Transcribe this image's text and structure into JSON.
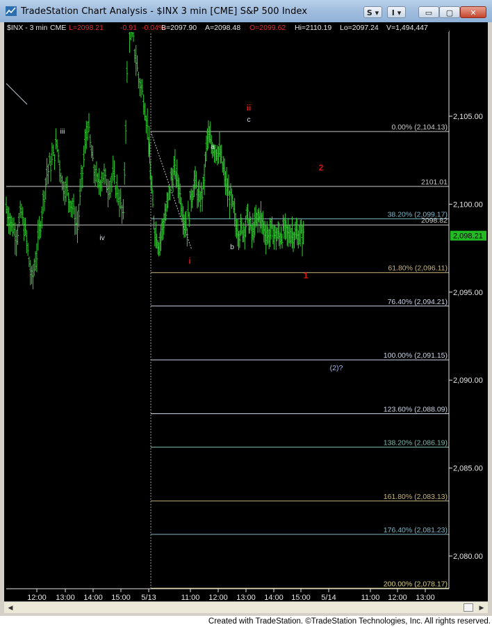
{
  "window": {
    "title": "TradeStation Chart Analysis - $INX 3 min [CME] S&P 500 Index",
    "buttons": {
      "s": "S",
      "i": "I",
      "minimize": "▭",
      "maximize": "▢",
      "close": "✕"
    }
  },
  "status": {
    "symbol": "$INX - 3 min",
    "exchange": "CME",
    "last": "L=2098.21",
    "change": "-0.91",
    "change_pct": "-0.04%",
    "bid": "B=2097.90",
    "ask": "A=2098.48",
    "open": "O=2099.62",
    "high": "Hi=2110.19",
    "low": "Lo=2097.24",
    "volume": "V=1,494,447"
  },
  "footer": "Created with TradeStation. ©TradeStation Technologies, Inc. All rights reserved.",
  "colors": {
    "background": "#000000",
    "price_bars": "#33cc33",
    "fib_lines": "#b7c7d6",
    "text_light": "#d6dde6",
    "red": "#dd1111",
    "last_price_bg": "#22bb22"
  },
  "chart_data": {
    "type": "line",
    "title": "",
    "xlabel": "",
    "ylabel": "",
    "ylim": [
      2076.8,
      2111.7
    ],
    "y_ticks": [
      2080,
      2085,
      2090,
      2095,
      2100,
      2105
    ],
    "y_tick_labels": [
      "2,080.00",
      "2,085.00",
      "2,090.00",
      "2,095.00",
      "2,100.00",
      "2,105.00"
    ],
    "x_ticks": [
      "12:00",
      "13:00",
      "14:00",
      "15:00",
      "5/13",
      "11:00",
      "12:00",
      "13:00",
      "14:00",
      "15:00",
      "5/14",
      "11:00",
      "12:00",
      "13:00"
    ],
    "session_break": "5/13",
    "last_price": 2098.21,
    "last_price_label": "2,098.21",
    "series": [
      {
        "x": [
          "11:40",
          "11:49",
          "11:58",
          "12:07",
          "12:16",
          "12:25",
          "12:34",
          "12:43",
          "12:52",
          "13:01",
          "13:10",
          "13:19",
          "13:28",
          "13:37",
          "13:46",
          "13:55",
          "14:04",
          "14:13",
          "14:22",
          "14:31",
          "14:40",
          "14:49",
          "14:58",
          "15:07",
          "15:16",
          "15:25",
          "15:34",
          "15:43",
          "15:52",
          "5/13 9:30",
          "9:39",
          "9:48",
          "9:57",
          "10:06",
          "10:15",
          "10:24",
          "10:33",
          "10:42",
          "10:51",
          "11:00",
          "11:09",
          "11:18",
          "11:27",
          "11:36",
          "11:45",
          "11:54",
          "12:03",
          "12:12",
          "12:21",
          "12:30",
          "12:39",
          "12:48",
          "12:57",
          "13:06",
          "13:15",
          "13:24",
          "13:33",
          "13:42",
          "13:51",
          "14:00",
          "14:09",
          "14:18",
          "14:27",
          "14:36",
          "14:45",
          "14:54",
          "15:03",
          "15:12"
        ],
        "y": [
          2099.8,
          2098.9,
          2098.3,
          2099.5,
          2097.9,
          2095.6,
          2097.2,
          2099.6,
          2101.8,
          2102.5,
          2103.4,
          2101.2,
          2100.7,
          2099.9,
          2098.7,
          2101.9,
          2104.6,
          2102.3,
          2101.1,
          2101.7,
          2101.0,
          2101.5,
          2100.6,
          2099.2,
          2110.0,
          2109.3,
          2107.2,
          2106.1,
          2103.8,
          2101.2,
          2098.6,
          2097.7,
          2098.8,
          2099.7,
          2101.4,
          2101.9,
          2101.0,
          2099.4,
          2098.7,
          2100.5,
          2101.3,
          2100.1,
          2100.9,
          2103.8,
          2103.4,
          2103.2,
          2102.9,
          2101.9,
          2100.7,
          2100.2,
          2098.9,
          2098.4,
          2098.6,
          2099.3,
          2098.3,
          2098.9,
          2099.4,
          2098.6,
          2098.2,
          2098.5,
          2098.21,
          2098.2,
          2098.5,
          2098.3,
          2098.4,
          2098.2,
          2098.3,
          2098.21
        ]
      }
    ],
    "horizontal_levels": [
      {
        "label": "0.00% (2,104.13)",
        "value": 2104.13
      },
      {
        "label": "2101.01",
        "value": 2101.01
      },
      {
        "label": "38.20% (2,099.17)",
        "value": 2099.17
      },
      {
        "label": "2098.82",
        "value": 2098.82
      },
      {
        "label": "61.80% (2,096.11)",
        "value": 2096.11
      },
      {
        "label": "76.40% (2,094.21)",
        "value": 2094.21
      },
      {
        "label": "100.00% (2,091.15)",
        "value": 2091.15
      },
      {
        "label": "123.60% (2,088.09)",
        "value": 2088.09
      },
      {
        "label": "138.20% (2,086.19)",
        "value": 2086.19
      },
      {
        "label": "161.80% (2,083.13)",
        "value": 2083.13
      },
      {
        "label": "176.40% (2,081.23)",
        "value": 2081.23
      },
      {
        "label": "200.00% (2,078.17)",
        "value": 2078.17
      }
    ],
    "annotations": [
      {
        "text": "iii",
        "color": "light"
      },
      {
        "text": "iv",
        "color": "light"
      },
      {
        "text": "i",
        "color": "red"
      },
      {
        "text": "a",
        "color": "light"
      },
      {
        "text": "b",
        "color": "light"
      },
      {
        "text": "c",
        "color": "light"
      },
      {
        "text": "ii",
        "color": "red"
      },
      {
        "text": "2",
        "color": "red"
      },
      {
        "text": "1",
        "color": "red"
      },
      {
        "text": "(2)?",
        "color": "blue"
      }
    ],
    "grid": false,
    "legend": "none"
  }
}
